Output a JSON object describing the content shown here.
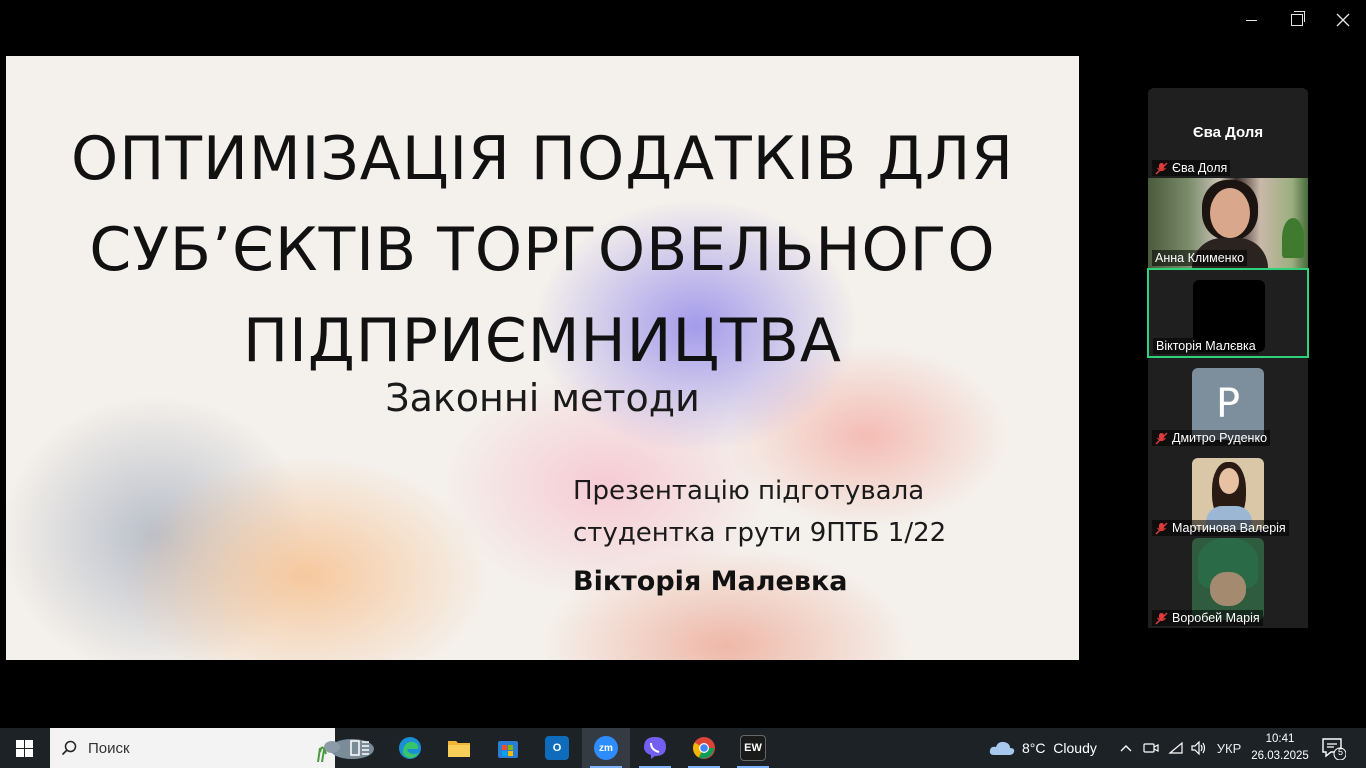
{
  "window": {
    "minimize_icon": "minimize-icon",
    "restore_icon": "restore-icon",
    "close_icon": "close-icon"
  },
  "slide": {
    "title_lines": [
      "ОПТИМІЗАЦІЯ ПОДАТКІВ ДЛЯ",
      "СУБ’ЄКТІВ ТОРГОВЕЛЬНОГО",
      "ПІДПРИЄМНИЦТВА"
    ],
    "subtitle": "Законні методи",
    "author_line1": "Презентацію підготувала",
    "author_line2": "студентка грути 9ПТБ 1/22",
    "author_name": "Вікторія Малевка"
  },
  "participants": {
    "header_name": "Єва Доля",
    "items": [
      {
        "name": "Єва Доля",
        "muted": true,
        "video": "none"
      },
      {
        "name": "Анна Клименко",
        "muted": false,
        "video": "camera"
      },
      {
        "name": "Вікторія Малєвка",
        "muted": false,
        "video": "dark",
        "active": true
      },
      {
        "name": "Дмитро Руденко",
        "muted": true,
        "video": "avatar",
        "avatar_letter": "P"
      },
      {
        "name": "Мартинова Валерія",
        "muted": true,
        "video": "photo"
      },
      {
        "name": "Воробей Марія",
        "muted": true,
        "video": "photo"
      }
    ]
  },
  "taskbar": {
    "search_placeholder": "Поиск",
    "apps": [
      "task-view",
      "edge",
      "file-explorer",
      "microsoft-store",
      "outlook",
      "zoom",
      "viber",
      "chrome",
      "ew"
    ],
    "weather_temp": "8°C",
    "weather_text": "Cloudy",
    "language": "УКР",
    "time": "10:41",
    "date": "26.03.2025",
    "notifications_count": "5"
  },
  "colors": {
    "active_speaker_border": "#2fd27a",
    "taskbar_bg": "#1d2227",
    "panel_bg": "#1f1f1f"
  }
}
